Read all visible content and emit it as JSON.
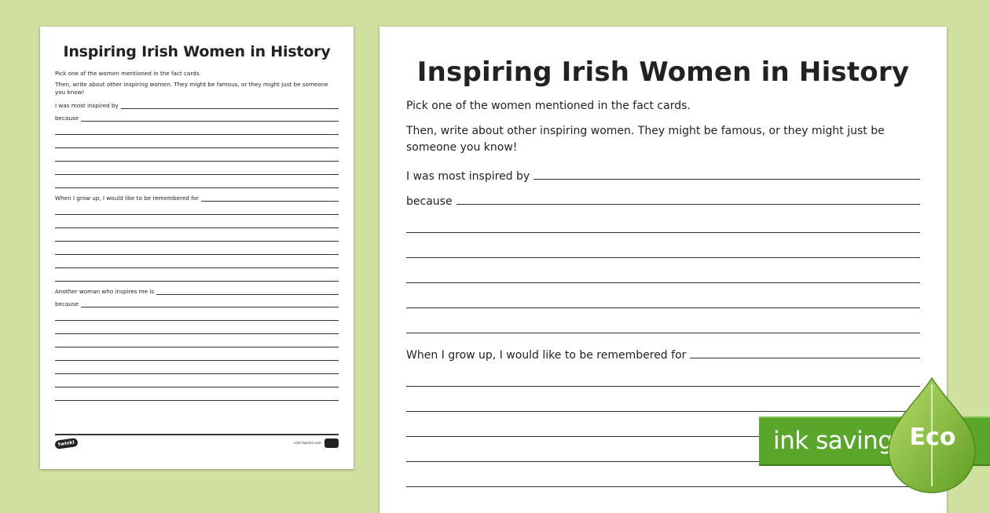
{
  "worksheet": {
    "title": "Inspiring Irish Women in History",
    "intro_1": "Pick one of the women mentioned in the fact cards.",
    "intro_2": "Then, write about other inspiring women. They might be famous, or they might just be someone you know!",
    "prompt_inspired": "I was most inspired by",
    "prompt_because": "because",
    "prompt_remembered": "When I grow up, I would like to be remembered for",
    "prompt_another": "Another woman who inspires me is",
    "prompt_because_2": "because"
  },
  "footer": {
    "logo_text": "twinkl",
    "url": "visit twinkl.com"
  },
  "eco_badge": {
    "text": "ink saving",
    "label": "Eco",
    "color": "#5aa62a"
  },
  "colors": {
    "background": "#cfe0a0",
    "paper": "#ffffff",
    "rule": "#333333"
  }
}
